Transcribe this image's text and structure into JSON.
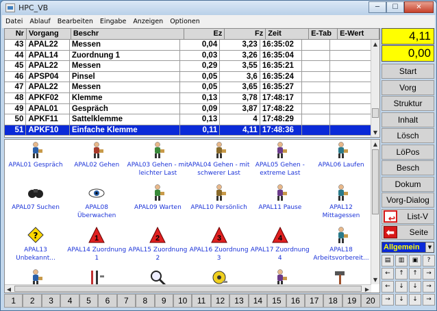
{
  "window": {
    "title": "HPC_VB",
    "min_label": "─",
    "max_label": "☐",
    "close_label": "✕"
  },
  "menu": [
    "Datei",
    "Ablauf",
    "Bearbeiten",
    "Eingabe",
    "Anzeigen",
    "Optionen"
  ],
  "table": {
    "headers": [
      "Nr",
      "Vorgang",
      "Beschr",
      "Ez",
      "Fz",
      "Zeit",
      "E-Tab",
      "E-Wert"
    ],
    "rows": [
      [
        "43",
        "APAL22",
        "Messen",
        "0,04",
        "3,23",
        "16:35:02",
        "",
        ""
      ],
      [
        "44",
        "APAL14",
        "Zuordnung 1",
        "0,03",
        "3,26",
        "16:35:04",
        "",
        ""
      ],
      [
        "45",
        "APAL22",
        "Messen",
        "0,29",
        "3,55",
        "16:35:21",
        "",
        ""
      ],
      [
        "46",
        "APSP04",
        "Pinsel",
        "0,05",
        "3,6",
        "16:35:24",
        "",
        ""
      ],
      [
        "47",
        "APAL22",
        "Messen",
        "0,05",
        "3,65",
        "16:35:27",
        "",
        ""
      ],
      [
        "48",
        "APKF02",
        "Klemme",
        "0,13",
        "3,78",
        "17:48:17",
        "",
        ""
      ],
      [
        "49",
        "APAL01",
        "Gespräch",
        "0,09",
        "3,87",
        "17:48:22",
        "",
        ""
      ],
      [
        "50",
        "APKF11",
        "Sattelklemme",
        "0,13",
        "4",
        "17:48:29",
        "",
        ""
      ],
      [
        "51",
        "APKF10",
        "Einfache Klemme",
        "0,11",
        "4,11",
        "17:48:36",
        "",
        ""
      ]
    ],
    "selected_row": 8
  },
  "icons": [
    {
      "label": "APAL01 Gespräch",
      "icon": "people-talking-icon"
    },
    {
      "label": "APAL02 Gehen",
      "icon": "walking-person-icon"
    },
    {
      "label": "APAL03 Gehen - mit leichter Last",
      "icon": "carry-light-load-icon"
    },
    {
      "label": "APAL04 Gehen - mit schwerer Last",
      "icon": "carry-heavy-load-icon"
    },
    {
      "label": "APAL05 Gehen - extreme Last",
      "icon": "carry-extreme-load-icon"
    },
    {
      "label": "APAL06 Laufen",
      "icon": "running-person-icon"
    },
    {
      "label": "APAL07 Suchen",
      "icon": "binoculars-icon"
    },
    {
      "label": "APAL08 Überwachen",
      "icon": "eye-icon"
    },
    {
      "label": "APAL09 Warten",
      "icon": "waiting-person-icon"
    },
    {
      "label": "APAL10 Persönlich",
      "icon": "personal-icon"
    },
    {
      "label": "APAL11 Pause",
      "icon": "pause-person-icon"
    },
    {
      "label": "APAL12 Mittagessen",
      "icon": "lunch-icon"
    },
    {
      "label": "APAL13 Unbekannt...",
      "icon": "unknown-sign-icon"
    },
    {
      "label": "APAL14 Zuordnung 1",
      "icon": "triangle-1-icon"
    },
    {
      "label": "APAL15 Zuordnung 2",
      "icon": "triangle-2-icon"
    },
    {
      "label": "APAL16 Zuordnung 3",
      "icon": "triangle-3-icon"
    },
    {
      "label": "APAL17 Zuordnung 4",
      "icon": "triangle-4-icon"
    },
    {
      "label": "APAL18 Arbeitsvorbereit...",
      "icon": "work-prep-icon"
    },
    {
      "label": "",
      "icon": "worker-toolbox-icon"
    },
    {
      "label": "",
      "icon": "tools-icon"
    },
    {
      "label": "",
      "icon": "magnifier-icon"
    },
    {
      "label": "",
      "icon": "measuring-tape-icon"
    },
    {
      "label": "",
      "icon": "worker-icon"
    },
    {
      "label": "",
      "icon": "hammer-icon"
    }
  ],
  "triangle_numbers": [
    "1",
    "2",
    "3",
    "4"
  ],
  "sidebar": {
    "value_top": "4,11",
    "value_bottom": "0,00",
    "buttons": [
      "Start",
      "Vorg",
      "Struktur",
      "Inhalt",
      "Lösch",
      "LöPos",
      "Besch",
      "Dokum",
      "Vorg-Dialog"
    ],
    "listv_label": "List-V",
    "seite_label": "Seite",
    "dropdown_value": "Allgemein",
    "toolbar": [
      "▤",
      "▥",
      "▣",
      "?",
      "←",
      "↑",
      "↑",
      "→",
      "←",
      "↓",
      "↓",
      "→",
      "→",
      "↓",
      "↓",
      "→"
    ]
  },
  "bottom_buttons": [
    "1",
    "2",
    "3",
    "4",
    "5",
    "6",
    "7",
    "8",
    "9",
    "10",
    "11",
    "12",
    "13",
    "14",
    "15",
    "16",
    "17",
    "18",
    "19",
    "20"
  ],
  "colors": {
    "selection": "#0a2ad8",
    "highlight": "#ffff00",
    "label_text": "#1a32d8",
    "danger": "#d81818"
  }
}
